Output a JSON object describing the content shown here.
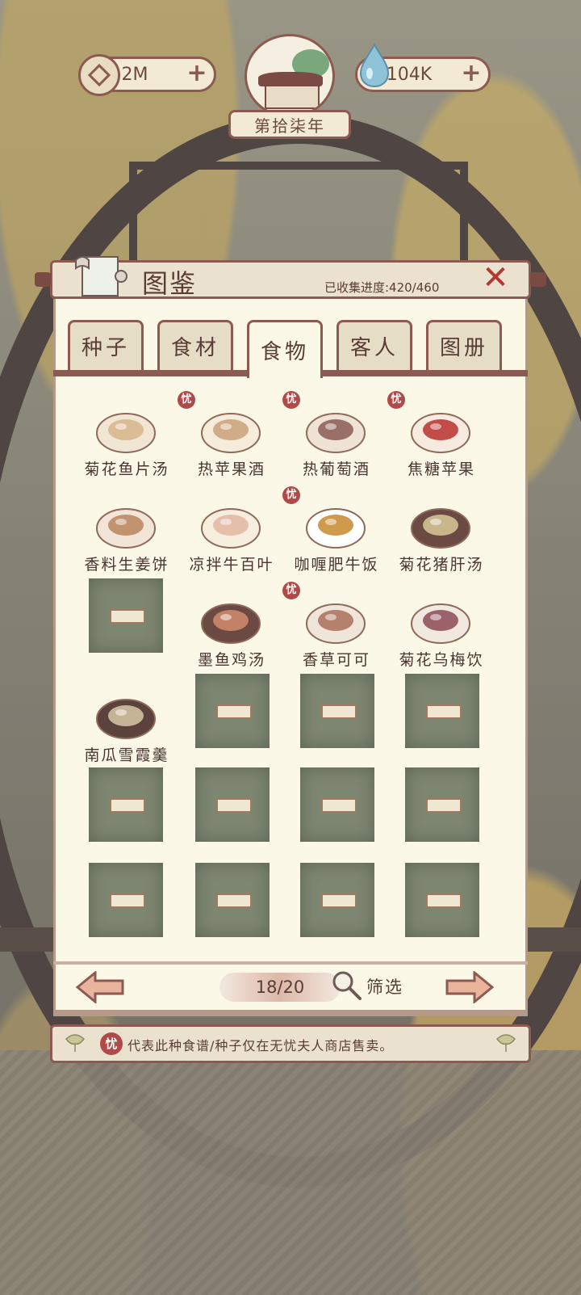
{
  "hud": {
    "coins": "2M",
    "water": "104K",
    "year": "第拾柒年"
  },
  "panel": {
    "title": "图鉴",
    "progress": "已收集进度:420/460"
  },
  "tabs": [
    {
      "label": "种子",
      "active": false
    },
    {
      "label": "食材",
      "active": false
    },
    {
      "label": "食物",
      "active": true
    },
    {
      "label": "客人",
      "active": false
    },
    {
      "label": "图册",
      "active": false
    }
  ],
  "badge_char": "忧",
  "items": [
    {
      "name": "菊花鱼片汤",
      "locked": false,
      "exclusive": false
    },
    {
      "name": "热苹果酒",
      "locked": false,
      "exclusive": true
    },
    {
      "name": "热葡萄酒",
      "locked": false,
      "exclusive": true
    },
    {
      "name": "焦糖苹果",
      "locked": false,
      "exclusive": true
    },
    {
      "name": "香料生姜饼",
      "locked": false,
      "exclusive": false
    },
    {
      "name": "凉拌牛百叶",
      "locked": false,
      "exclusive": false
    },
    {
      "name": "咖喱肥牛饭",
      "locked": false,
      "exclusive": true
    },
    {
      "name": "菊花猪肝汤",
      "locked": false,
      "exclusive": false
    },
    {
      "name": "",
      "locked": true,
      "exclusive": false
    },
    {
      "name": "墨鱼鸡汤",
      "locked": false,
      "exclusive": false
    },
    {
      "name": "香草可可",
      "locked": false,
      "exclusive": true
    },
    {
      "name": "菊花乌梅饮",
      "locked": false,
      "exclusive": false
    },
    {
      "name": "南瓜雪霞羹",
      "locked": false,
      "exclusive": false
    }
  ],
  "nav": {
    "page": "18/20",
    "filter": "筛选"
  },
  "note": {
    "badge": "忧",
    "text": "代表此种食谱/种子仅在无忧夫人商店售卖。"
  }
}
